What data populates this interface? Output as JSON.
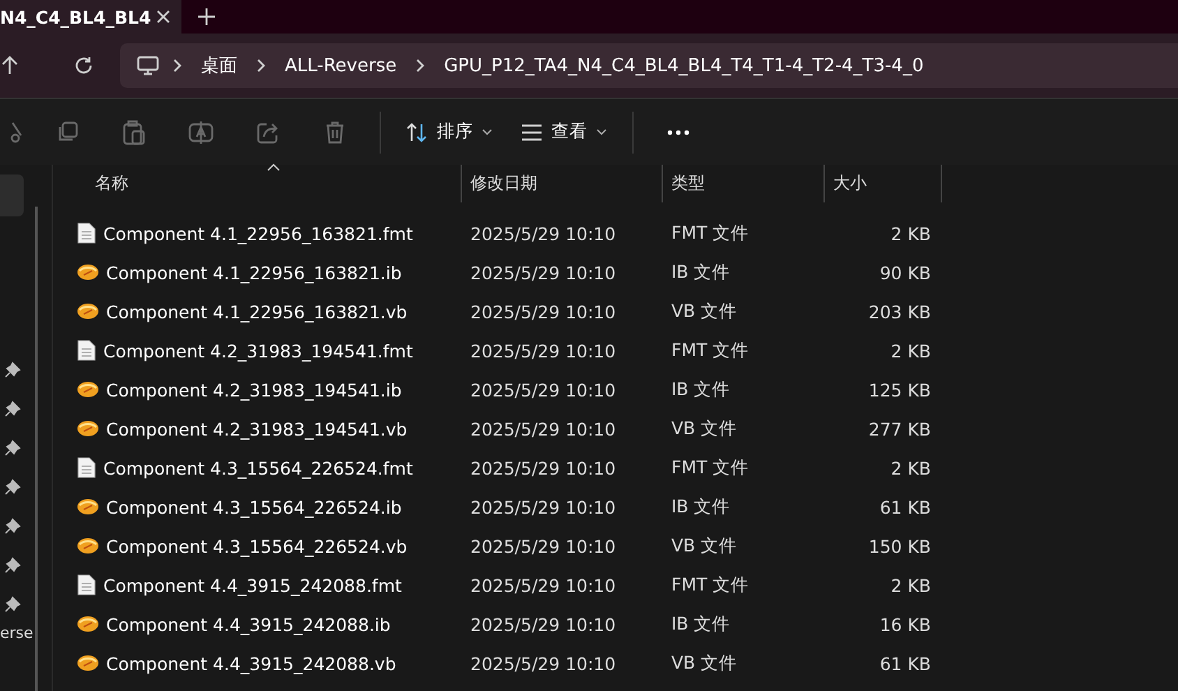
{
  "tab": {
    "title": "N4_C4_BL4_BL4"
  },
  "breadcrumb": [
    "桌面",
    "ALL-Reverse",
    "GPU_P12_TA4_N4_C4_BL4_BL4_T4_T1-4_T2-4_T3-4_0"
  ],
  "toolbar": {
    "sort_label": "排序",
    "view_label": "查看"
  },
  "sidebar": {
    "pinned_count_text": "erse"
  },
  "table": {
    "columns": [
      "名称",
      "修改日期",
      "类型",
      "大小"
    ],
    "rows": [
      {
        "kind": "doc",
        "name": "Component 4.1_22956_163821.fmt",
        "date": "2025/5/29 10:10",
        "type": "FMT 文件",
        "size": "2 KB"
      },
      {
        "kind": "data",
        "name": "Component 4.1_22956_163821.ib",
        "date": "2025/5/29 10:10",
        "type": "IB 文件",
        "size": "90 KB"
      },
      {
        "kind": "data",
        "name": "Component 4.1_22956_163821.vb",
        "date": "2025/5/29 10:10",
        "type": "VB 文件",
        "size": "203 KB"
      },
      {
        "kind": "doc",
        "name": "Component 4.2_31983_194541.fmt",
        "date": "2025/5/29 10:10",
        "type": "FMT 文件",
        "size": "2 KB"
      },
      {
        "kind": "data",
        "name": "Component 4.2_31983_194541.ib",
        "date": "2025/5/29 10:10",
        "type": "IB 文件",
        "size": "125 KB"
      },
      {
        "kind": "data",
        "name": "Component 4.2_31983_194541.vb",
        "date": "2025/5/29 10:10",
        "type": "VB 文件",
        "size": "277 KB"
      },
      {
        "kind": "doc",
        "name": "Component 4.3_15564_226524.fmt",
        "date": "2025/5/29 10:10",
        "type": "FMT 文件",
        "size": "2 KB"
      },
      {
        "kind": "data",
        "name": "Component 4.3_15564_226524.ib",
        "date": "2025/5/29 10:10",
        "type": "IB 文件",
        "size": "61 KB"
      },
      {
        "kind": "data",
        "name": "Component 4.3_15564_226524.vb",
        "date": "2025/5/29 10:10",
        "type": "VB 文件",
        "size": "150 KB"
      },
      {
        "kind": "doc",
        "name": "Component 4.4_3915_242088.fmt",
        "date": "2025/5/29 10:10",
        "type": "FMT 文件",
        "size": "2 KB"
      },
      {
        "kind": "data",
        "name": "Component 4.4_3915_242088.ib",
        "date": "2025/5/29 10:10",
        "type": "IB 文件",
        "size": "16 KB"
      },
      {
        "kind": "data",
        "name": "Component 4.4_3915_242088.vb",
        "date": "2025/5/29 10:10",
        "type": "VB 文件",
        "size": "61 KB"
      }
    ]
  }
}
